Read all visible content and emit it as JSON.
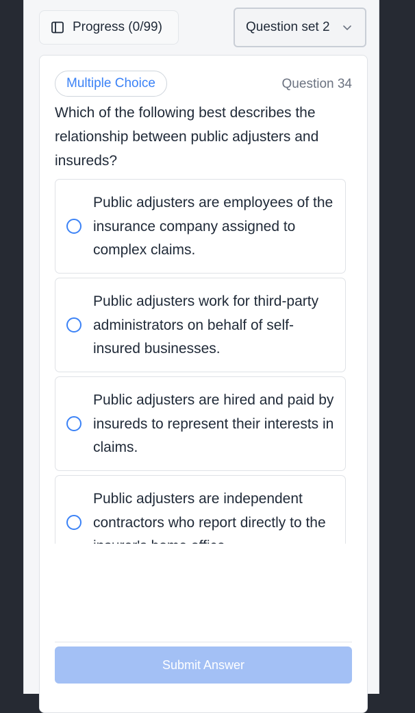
{
  "header": {
    "progress_label": "Progress (0/99)",
    "progress_icon": "sidebar-panel-icon",
    "set_selected": "Question set 2",
    "set_icon": "chevron-down-icon"
  },
  "question": {
    "type_badge": "Multiple Choice",
    "number_label": "Question 34",
    "text": "Which of the following best describes the relationship between public adjusters and insureds?",
    "options": [
      {
        "label": "Public adjusters are employees of the insurance company assigned to complex claims."
      },
      {
        "label": "Public adjusters work for third-party administrators on behalf of self-insured businesses."
      },
      {
        "label": "Public adjusters are hired and paid by insureds to represent their interests in claims."
      },
      {
        "label": "Public adjusters are independent contractors who report directly to the insurer's home office."
      }
    ]
  },
  "actions": {
    "submit_label": "Submit Answer"
  },
  "colors": {
    "accent": "#3b82f6",
    "submit_disabled": "#a3c0f5",
    "backdrop": "#262a33"
  }
}
